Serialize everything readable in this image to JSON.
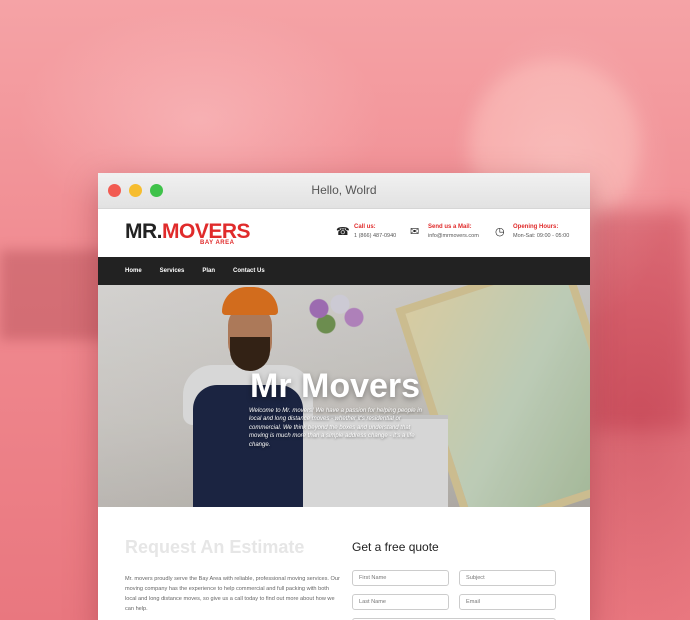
{
  "window": {
    "title": "Hello, Wolrd"
  },
  "logo": {
    "part1": "MR.",
    "part2": "MOVERS",
    "tagline": "BAY AREA"
  },
  "contact": {
    "call": {
      "label": "Call us:",
      "value": "1 (866) 487-0940"
    },
    "mail": {
      "label": "Send us a Mail:",
      "value": "info@mrmovers.com"
    },
    "hours": {
      "label": "Opening Hours:",
      "value": "Mon-Sat: 09:00 - 05:00"
    }
  },
  "nav": {
    "items": [
      "Home",
      "Services",
      "Plan",
      "Contact Us"
    ]
  },
  "hero": {
    "title": "Mr Movers",
    "text": "Welcome to Mr. movers! We have a passion for helping people in local and long distance moves - whether it's residential or commercial. We think beyond the boxes and understand that moving is much more than a simple address change - it's a life change."
  },
  "estimate": {
    "heading": "Request An Estimate",
    "text": "Mr. movers proudly serve the Bay Area with reliable, professional moving services. Our moving company has the experience to help commercial and full packing with both local and long distance moves, so give us a call today to find out more about how we can help."
  },
  "quote": {
    "heading": "Get a free quote",
    "first_name": "First Name",
    "subject": "Subject",
    "last_name": "Last Name",
    "email": "Email"
  },
  "colors": {
    "brand_red": "#e02b2b",
    "nav_bg": "#222222",
    "backdrop_pink": "#f0868c"
  }
}
